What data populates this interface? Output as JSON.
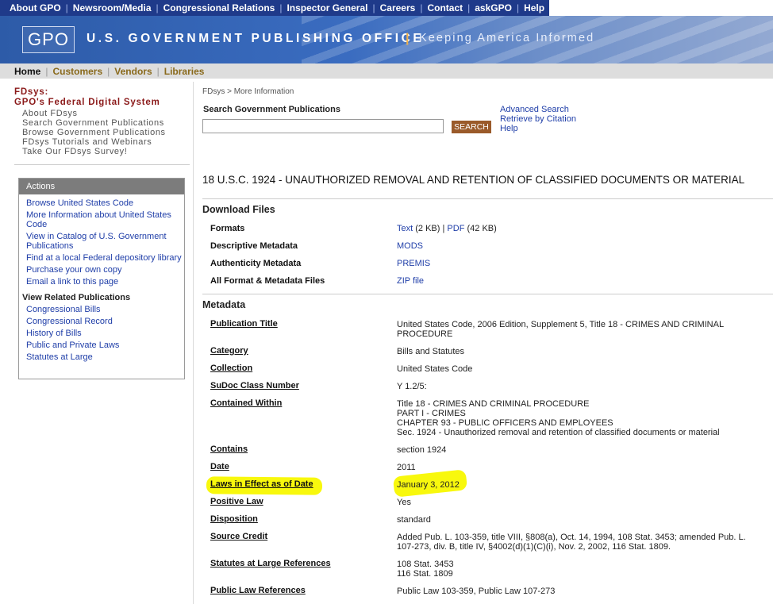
{
  "top_nav": [
    "About GPO",
    "Newsroom/Media",
    "Congressional Relations",
    "Inspector General",
    "Careers",
    "Contact",
    "askGPO",
    "Help"
  ],
  "banner": {
    "logo_text": "GPO",
    "title": "U.S. GOVERNMENT PUBLISHING OFFICE",
    "separator": "|",
    "tagline": "Keeping America Informed"
  },
  "sub_nav": [
    "Home",
    "Customers",
    "Vendors",
    "Libraries"
  ],
  "fdsys": {
    "title1": "FDsys:",
    "title2": "GPO's Federal Digital System",
    "links": [
      "About FDsys",
      "Search Government Publications",
      "Browse Government Publications",
      "FDsys Tutorials and Webinars",
      "Take Our FDsys Survey!"
    ]
  },
  "actions": {
    "title": "Actions",
    "links": [
      "Browse United States Code",
      "More Information about United States Code",
      "View in Catalog of U.S. Government Publications",
      "Find at a local Federal depository library",
      "Purchase your own copy",
      "Email a link to this page"
    ],
    "related_title": "View Related Publications",
    "related_links": [
      "Congressional Bills",
      "Congressional Record",
      "History of Bills",
      "Public and Private Laws",
      "Statutes at Large"
    ]
  },
  "breadcrumb": "FDsys > More Information",
  "search": {
    "label": "Search Government Publications",
    "value": "",
    "button": "SEARCH",
    "links": [
      "Advanced Search",
      "Retrieve by Citation",
      "Help"
    ]
  },
  "document_title": "18 U.S.C. 1924 - UNAUTHORIZED REMOVAL AND RETENTION OF CLASSIFIED DOCUMENTS OR MATERIAL",
  "download": {
    "heading": "Download Files",
    "formats_label": "Formats",
    "text_link": "Text",
    "text_size": "(2 KB)",
    "pipe": "|",
    "pdf_link": "PDF",
    "pdf_size": "(42 KB)",
    "desc_label": "Descriptive Metadata",
    "desc_link": "MODS",
    "auth_label": "Authenticity Metadata",
    "auth_link": "PREMIS",
    "all_label": "All Format & Metadata Files",
    "all_link": "ZIP file"
  },
  "metadata": {
    "heading": "Metadata",
    "publication_title_label": "Publication Title",
    "publication_title": "United States Code, 2006 Edition, Supplement 5, Title 18 - CRIMES AND CRIMINAL PROCEDURE",
    "category_label": "Category",
    "category": "Bills and Statutes",
    "collection_label": "Collection",
    "collection": "United States Code",
    "sudoc_label": "SuDoc Class Number",
    "sudoc": "Y 1.2/5:",
    "contained_label": "Contained Within",
    "contained": [
      "Title 18 - CRIMES AND CRIMINAL PROCEDURE",
      "PART I - CRIMES",
      "CHAPTER 93 - PUBLIC OFFICERS AND EMPLOYEES",
      "Sec. 1924 - Unauthorized removal and retention of classified documents or material"
    ],
    "contains_label": "Contains",
    "contains": "section 1924",
    "date_label": "Date",
    "date": "2011",
    "laws_label": "Laws in Effect as of Date",
    "laws": "January 3, 2012",
    "positive_label": "Positive Law",
    "positive": "Yes",
    "disposition_label": "Disposition",
    "disposition": "standard",
    "source_label": "Source Credit",
    "source": "Added Pub. L. 103-359, title VIII, §808(a), Oct. 14, 1994, 108 Stat. 3453; amended Pub. L. 107-273, div. B, title IV, §4002(d)(1)(C)(i), Nov. 2, 2002, 116 Stat. 1809.",
    "statutes_label": "Statutes at Large References",
    "statutes": [
      "108 Stat. 3453",
      "116 Stat. 1809"
    ],
    "public_law_label": "Public Law References",
    "public_law": "Public Law 103-359, Public Law 107-273"
  },
  "colors": {
    "top_nav": "#1f3a8a",
    "highlight": "#f8f800",
    "link": "#1f3ea8",
    "fdsys_title": "#8b1a1a"
  }
}
